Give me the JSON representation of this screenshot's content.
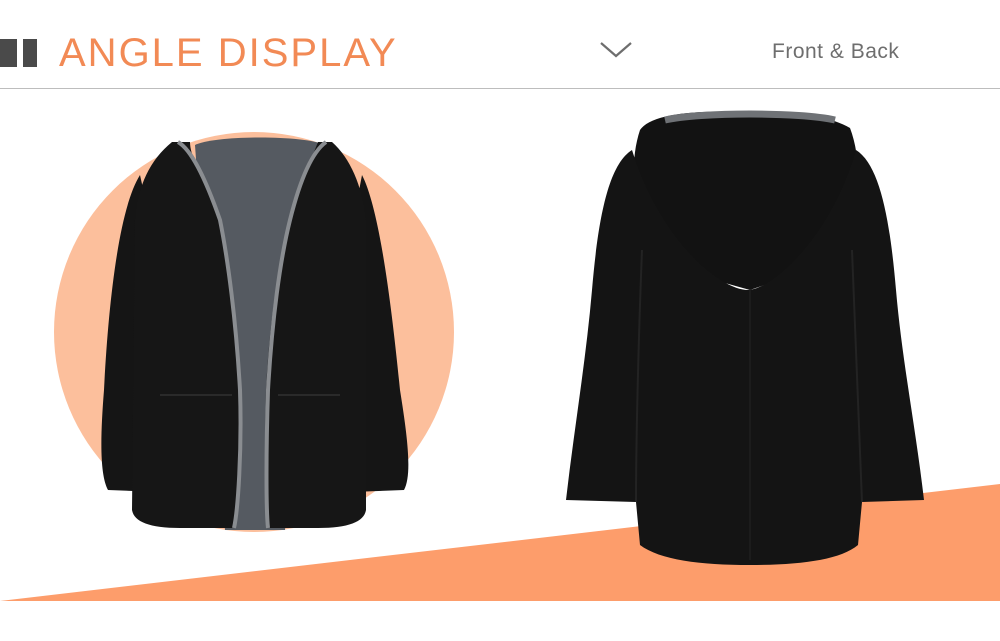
{
  "header": {
    "title": "ANGLE DISPLAY",
    "subtitle": "Front & Back",
    "accent_color": "#f28a55",
    "bar_color": "#4a4a4a",
    "chevron_icon": "chevron-down-icon"
  },
  "images": {
    "front": {
      "description_icon": "jacket-front-image"
    },
    "back": {
      "description_icon": "jacket-back-image"
    }
  },
  "colors": {
    "circle": "#fcbf9c",
    "stripe": "#fd9d6b",
    "garment": "#141414",
    "lining": "#555a61"
  }
}
